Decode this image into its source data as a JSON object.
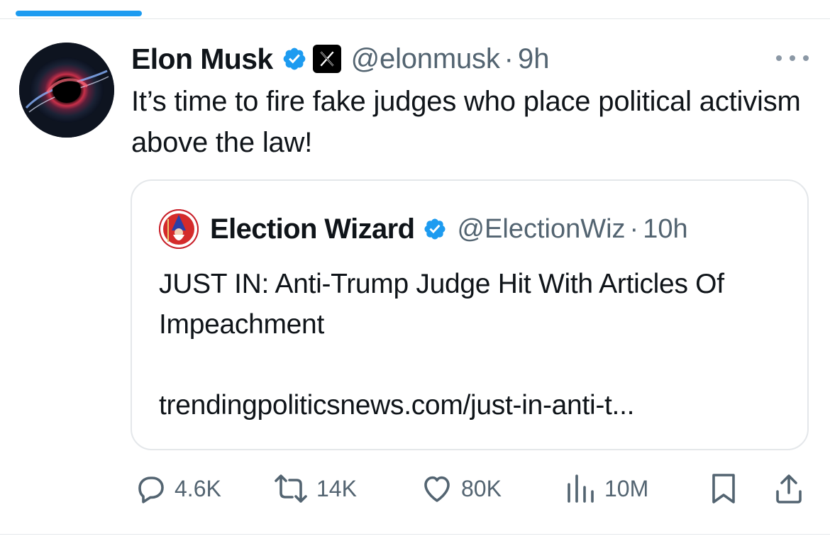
{
  "tweet": {
    "author_name": "Elon Musk",
    "handle": "@elonmusk",
    "separator": "·",
    "time": "9h",
    "text": "It’s time to fire fake judges who place political activism above the law!",
    "icons": [
      "verified-badge-icon",
      "x-affiliate-icon",
      "more-icon"
    ]
  },
  "quote": {
    "author_name": "Election Wizard",
    "handle": "@ElectionWiz",
    "separator": "·",
    "time": "10h",
    "text": "JUST IN: Anti-Trump Judge Hit With Articles Of Impeachment",
    "link": "trendingpoliticsnews.com/just-in-anti-t..."
  },
  "actions": {
    "replies": "4.6K",
    "reposts": "14K",
    "likes": "80K",
    "views": "10M"
  },
  "colors": {
    "accent": "#1d9bf0",
    "muted_text": "#536471",
    "primary_text": "#0f1419",
    "border": "#e4e7ea"
  }
}
